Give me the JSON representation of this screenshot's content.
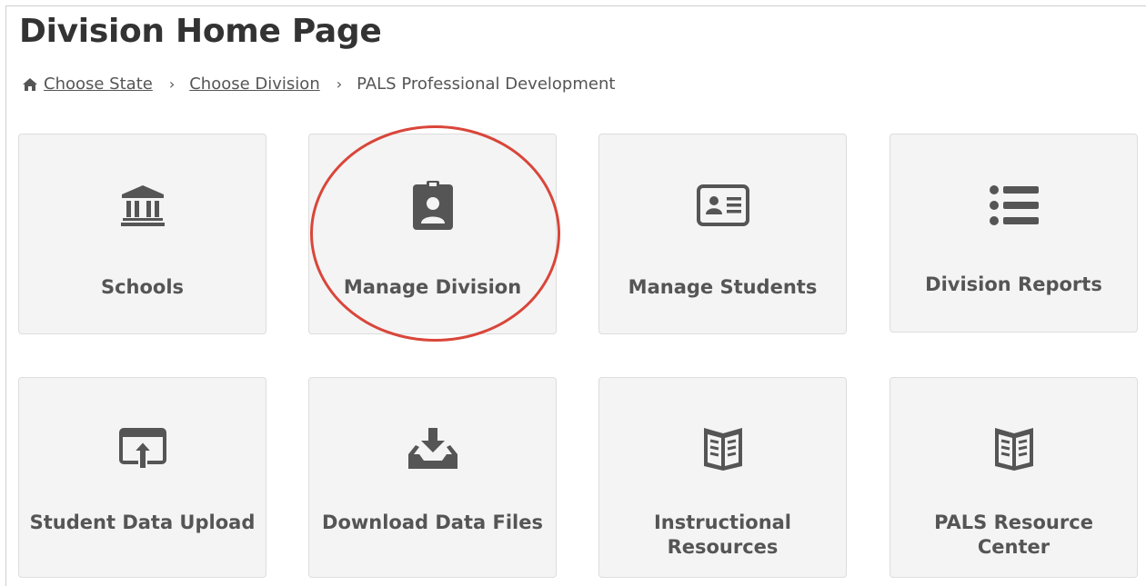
{
  "page_title": "Division Home Page",
  "breadcrumb": {
    "home_icon": "home-icon",
    "items": [
      {
        "label": "Choose State",
        "link": true
      },
      {
        "label": "Choose Division",
        "link": true
      },
      {
        "label": "PALS Professional Development",
        "link": false
      }
    ],
    "separator": "›"
  },
  "tiles": [
    {
      "label": "Schools",
      "icon": "bank-icon"
    },
    {
      "label": "Manage Division",
      "icon": "id-badge-icon",
      "highlighted": true
    },
    {
      "label": "Manage Students",
      "icon": "id-card-icon"
    },
    {
      "label": "Division Reports",
      "icon": "list-icon"
    },
    {
      "label": "Student Data Upload",
      "icon": "upload-window-icon"
    },
    {
      "label": "Download Data Files",
      "icon": "download-tray-icon"
    },
    {
      "label": "Instructional Resources",
      "icon": "open-book-icon"
    },
    {
      "label": "PALS Resource Center",
      "icon": "open-book-icon"
    }
  ],
  "colors": {
    "tile_background": "#f4f4f4",
    "icon": "#555555",
    "highlight_ring": "#d9463a"
  }
}
